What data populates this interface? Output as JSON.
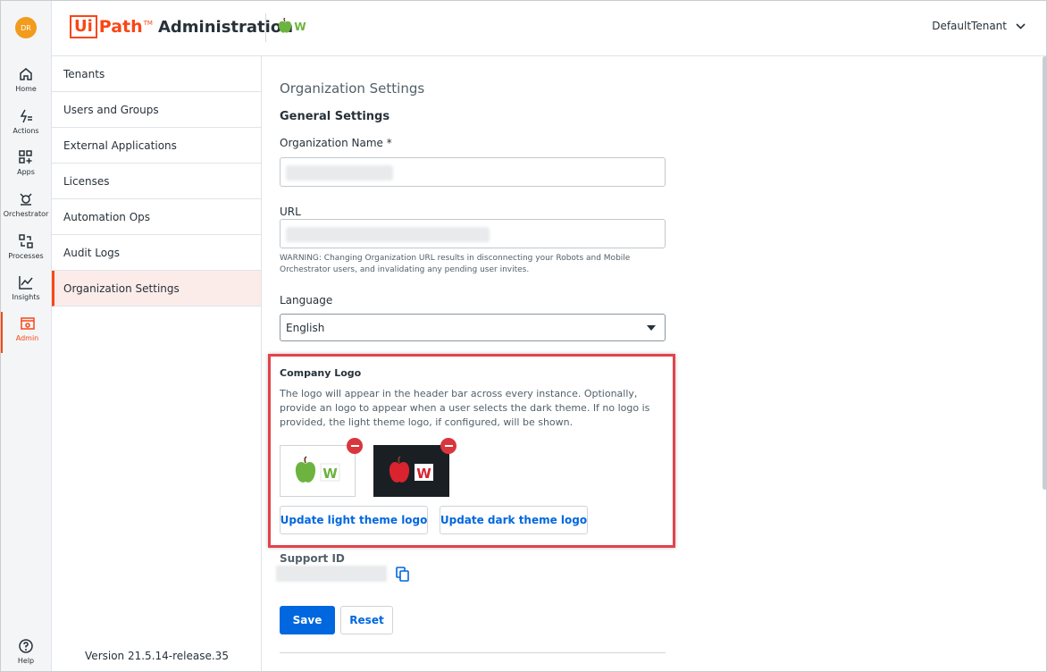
{
  "rail": {
    "avatar": "DR",
    "items": [
      {
        "label": "Home",
        "icon": "home-icon"
      },
      {
        "label": "Actions",
        "icon": "actions-icon"
      },
      {
        "label": "Apps",
        "icon": "apps-icon"
      },
      {
        "label": "Orchestrator",
        "icon": "orchestrator-icon"
      },
      {
        "label": "Processes",
        "icon": "processes-icon"
      },
      {
        "label": "Insights",
        "icon": "insights-icon"
      },
      {
        "label": "Admin",
        "icon": "admin-icon"
      }
    ],
    "help": "Help"
  },
  "header": {
    "brand_ui": "Ui",
    "brand_path": "Path",
    "brand_tm": "TM",
    "title": "Administration",
    "logo_letter": "W",
    "tenant": "DefaultTenant"
  },
  "subnav": {
    "items": [
      "Tenants",
      "Users and Groups",
      "External Applications",
      "Licenses",
      "Automation Ops",
      "Audit Logs",
      "Organization Settings"
    ],
    "active": "Organization Settings",
    "version": "Version 21.5.14-release.35"
  },
  "main": {
    "page_title": "Organization Settings",
    "section_title": "General Settings",
    "org_name_label": "Organization Name *",
    "url_label": "URL",
    "warning": "WARNING: Changing Organization URL results in disconnecting your Robots and Mobile Orchestrator users, and invalidating any pending user invites.",
    "language_label": "Language",
    "language_value": "English",
    "logo_title": "Company Logo",
    "logo_desc": "The logo will appear in the header bar across every instance. Optionally, provide an logo to appear when a user selects the dark theme. If no logo is provided, the light theme logo, if configured, will be shown.",
    "logo_letter": "W",
    "update_light": "Update light theme logo",
    "update_dark": "Update dark theme logo",
    "support_label": "Support ID",
    "save": "Save",
    "reset": "Reset"
  },
  "colors": {
    "accent": "#fa4616",
    "primary": "#0067df",
    "highlight": "#e2434b",
    "apple_green": "#6cb33f",
    "apple_red": "#d9232e"
  }
}
